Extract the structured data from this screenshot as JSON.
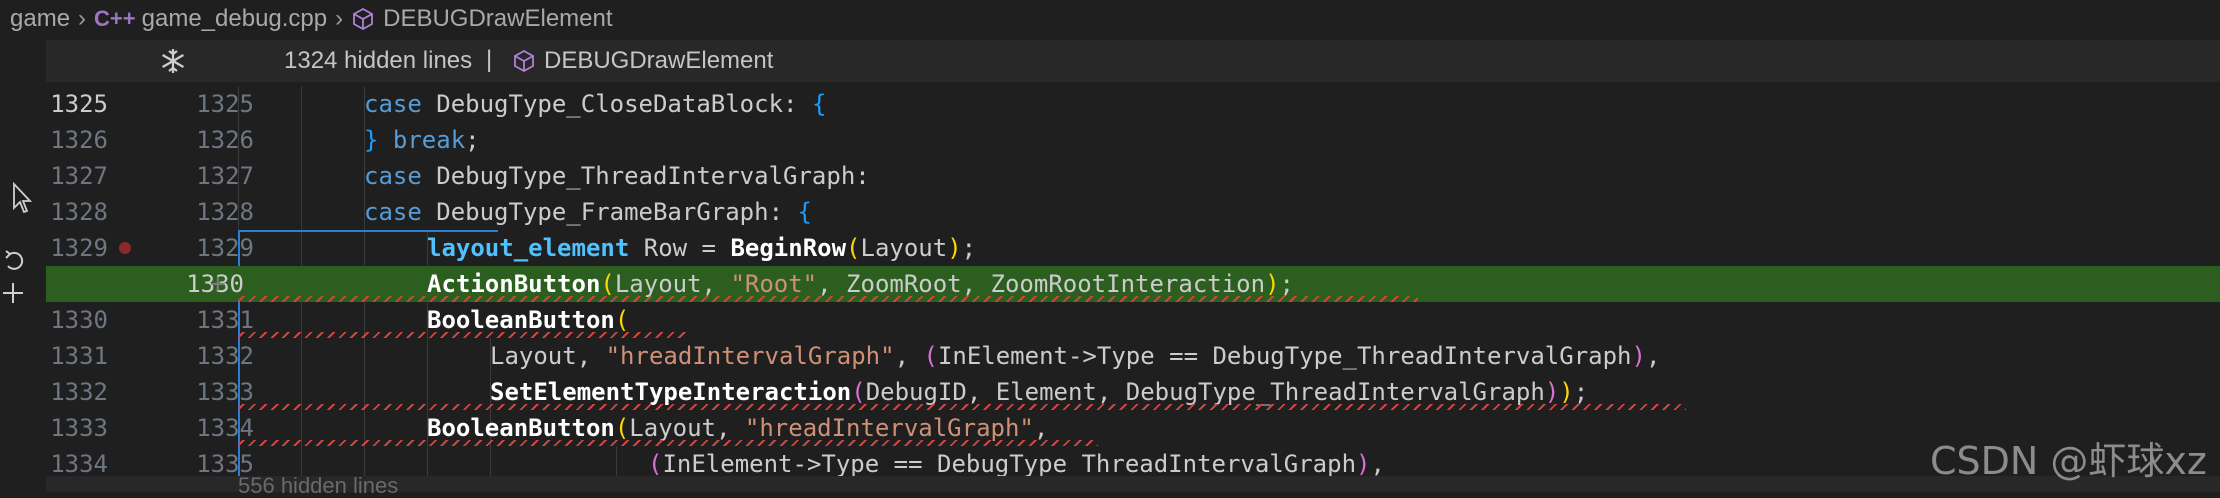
{
  "breadcrumb": {
    "root": "game",
    "file": "game_debug.cpp",
    "file_icon": "C++",
    "symbol": "DEBUGDrawElement"
  },
  "fold_banner": {
    "hidden_text": "1324 hidden lines",
    "separator": "|",
    "symbol": "DEBUGDrawElement"
  },
  "lines": [
    {
      "orig": "1325",
      "mod": "1325"
    },
    {
      "orig": "1326",
      "mod": "1326"
    },
    {
      "orig": "1327",
      "mod": "1327"
    },
    {
      "orig": "1328",
      "mod": "1328"
    },
    {
      "orig": "1329",
      "mod": "1329"
    },
    {
      "orig": "",
      "mod": "1330",
      "marker": "+"
    },
    {
      "orig": "1330",
      "mod": "1331"
    },
    {
      "orig": "1331",
      "mod": "1332"
    },
    {
      "orig": "1332",
      "mod": "1333"
    },
    {
      "orig": "1333",
      "mod": "1334"
    },
    {
      "orig": "1334",
      "mod": "1335"
    }
  ],
  "code": {
    "l0": [
      "case",
      " DebugType_CloseDataBlock: ",
      "{"
    ],
    "l1": [
      "}",
      " ",
      "break",
      ";"
    ],
    "l2": [
      "case",
      " DebugType_ThreadIntervalGraph:"
    ],
    "l3": [
      "case",
      " DebugType_FrameBarGraph: ",
      "{"
    ],
    "l4": [
      "layout_element",
      " Row = ",
      "BeginRow",
      "(",
      "Layout",
      ")",
      ";"
    ],
    "l5": [
      "ActionButton",
      "(",
      "Layout, ",
      "\"Root\"",
      ", ZoomRoot, ZoomRootInteraction",
      ")",
      ";"
    ],
    "l6": [
      "BooleanButton",
      "("
    ],
    "l7": [
      "Layout, ",
      "\"hreadIntervalGraph\"",
      ", ",
      "(",
      "InElement->Type == DebugType_ThreadIntervalGraph",
      ")",
      ","
    ],
    "l8": [
      "SetElementTypeInteraction",
      "(",
      "DebugID, Element, DebugType_ThreadIntervalGraph",
      ")",
      ")",
      ";"
    ],
    "l9": [
      "BooleanButton",
      "(",
      "Layout, ",
      "\"hreadIntervalGraph\"",
      ","
    ],
    "l10": [
      "(",
      "InElement->Type == DebugType_ThreadIntervalGraph",
      ")",
      ","
    ]
  },
  "bottom_banner": {
    "hidden_text": "556 hidden lines"
  },
  "watermark": "CSDN @虾球xz",
  "colors": {
    "added_line_bg": "#2c5f1f",
    "keyword": "#569cd6",
    "type": "#4fc1ff",
    "string": "#ce9178",
    "bracket_gold": "#ffd700",
    "bracket_orchid": "#da70d6",
    "bracket_blue": "#179fff",
    "squiggle": "#d0453f"
  }
}
